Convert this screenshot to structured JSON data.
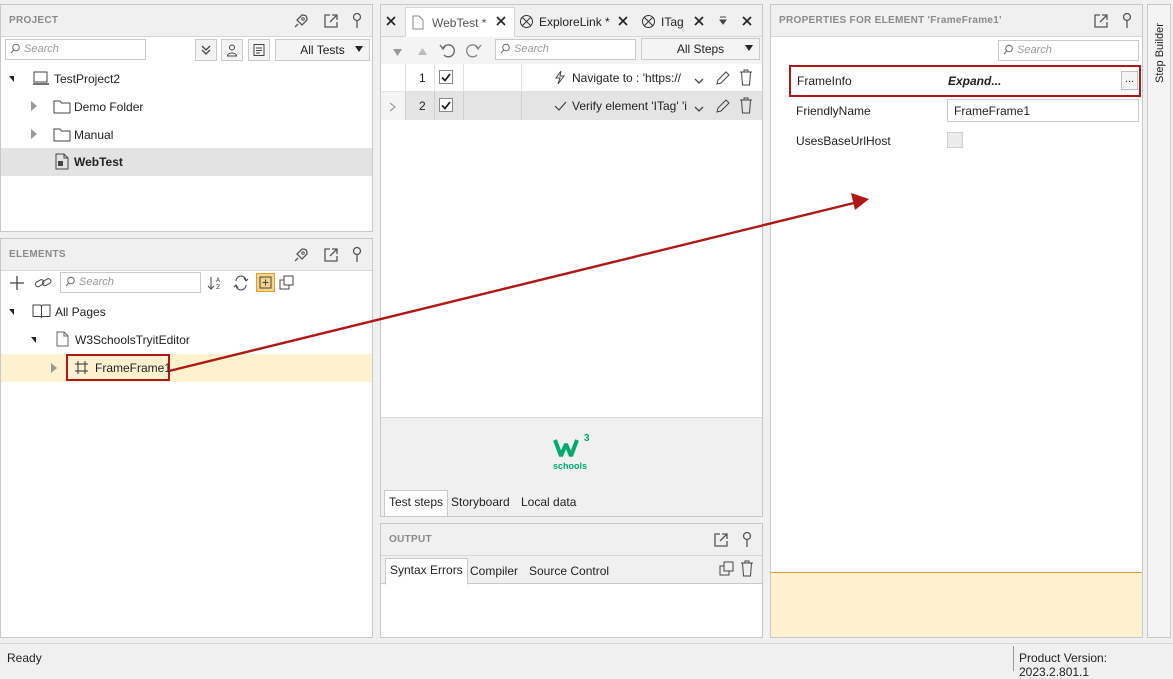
{
  "project": {
    "title": "PROJECT",
    "search_placeholder": "Search",
    "filter": "All Tests",
    "tree": [
      {
        "label": "TestProject2"
      },
      {
        "label": "Demo Folder"
      },
      {
        "label": "Manual"
      },
      {
        "label": "WebTest"
      }
    ]
  },
  "elements": {
    "title": "ELEMENTS",
    "search_placeholder": "Search",
    "tree": [
      {
        "label": "All Pages"
      },
      {
        "label": "W3SchoolsTryitEditor"
      },
      {
        "label": "FrameFrame1"
      }
    ]
  },
  "editor": {
    "tabs": [
      {
        "label": "WebTest *"
      },
      {
        "label": "ExploreLink *"
      },
      {
        "label": "ITag"
      }
    ],
    "search_placeholder": "Search",
    "filter": "All Steps",
    "steps": [
      {
        "num": "1",
        "text": "Navigate to : 'https://"
      },
      {
        "num": "2",
        "text": "Verify element 'ITag' 'i"
      }
    ],
    "logo_text": "schools",
    "logo_sup": "3",
    "bottom_tabs": [
      {
        "label": "Test steps"
      },
      {
        "label": "Storyboard"
      },
      {
        "label": "Local data"
      }
    ]
  },
  "output": {
    "title": "OUTPUT",
    "tabs": [
      {
        "label": "Syntax Errors"
      },
      {
        "label": "Compiler"
      },
      {
        "label": "Source Control"
      }
    ]
  },
  "properties": {
    "title": "PROPERTIES FOR ELEMENT 'FrameFrame1'",
    "search_placeholder": "Search",
    "rows": [
      {
        "name": "FrameInfo",
        "value": "Expand...",
        "btn": "..."
      },
      {
        "name": "FriendlyName",
        "value": "FrameFrame1"
      },
      {
        "name": "UsesBaseUrlHost",
        "value": ""
      }
    ]
  },
  "side_tab": "Step Builder",
  "status": {
    "left": "Ready",
    "right": "Product Version: 2023.2.801.1"
  },
  "colors": {
    "highlight": "#b01818",
    "selected_row": "#fdf1cf",
    "arrow": "#b01818"
  }
}
